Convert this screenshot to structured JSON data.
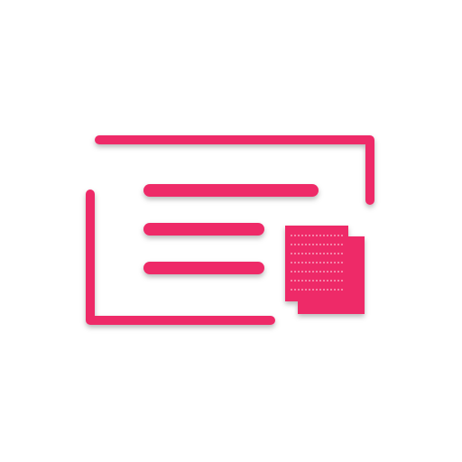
{
  "icon": {
    "name": "document-clipboard-icon",
    "accent_color": "#ee2a68",
    "background_color": "#ffffff",
    "shadow_color": "#000000"
  }
}
